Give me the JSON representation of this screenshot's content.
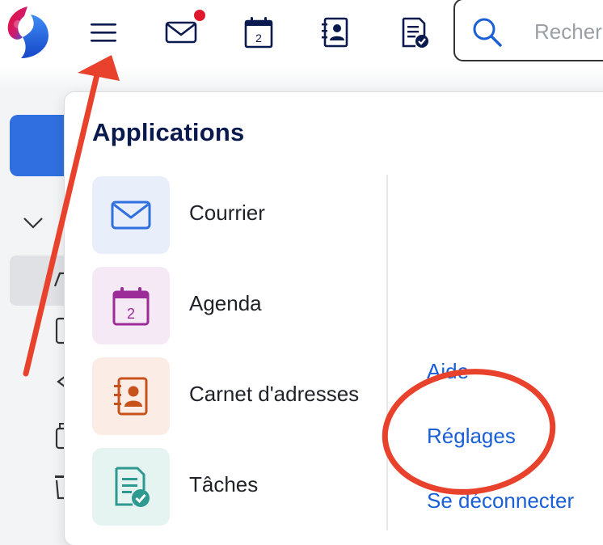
{
  "topbar": {
    "icons": [
      "logo",
      "menu-icon",
      "mail-icon",
      "calendar-icon",
      "contacts-icon",
      "tasks-icon"
    ],
    "calendar_day": "2",
    "mail_has_notification": true,
    "search_placeholder": "Recherc"
  },
  "panel": {
    "title": "Applications",
    "apps": [
      {
        "label": "Courrier",
        "icon": "mail-icon",
        "tile_color": "#e8eefa",
        "icon_color": "#2f6fdf"
      },
      {
        "label": "Agenda",
        "icon": "calendar-icon",
        "tile_color": "#f5e9f5",
        "icon_color": "#9b2c98",
        "day": "2"
      },
      {
        "label": "Carnet d'adresses",
        "icon": "contacts-icon",
        "tile_color": "#fbece6",
        "icon_color": "#c8521c"
      },
      {
        "label": "Tâches",
        "icon": "tasks-icon",
        "tile_color": "#e5f3f1",
        "icon_color": "#2e9990"
      }
    ],
    "links": {
      "help": "Aide",
      "settings": "Réglages",
      "logout": "Se déconnecter"
    }
  },
  "colors": {
    "accent": "#2f6fdf",
    "link": "#1a5fd6",
    "annotation": "#e8412c",
    "title": "#0b1a4e"
  }
}
